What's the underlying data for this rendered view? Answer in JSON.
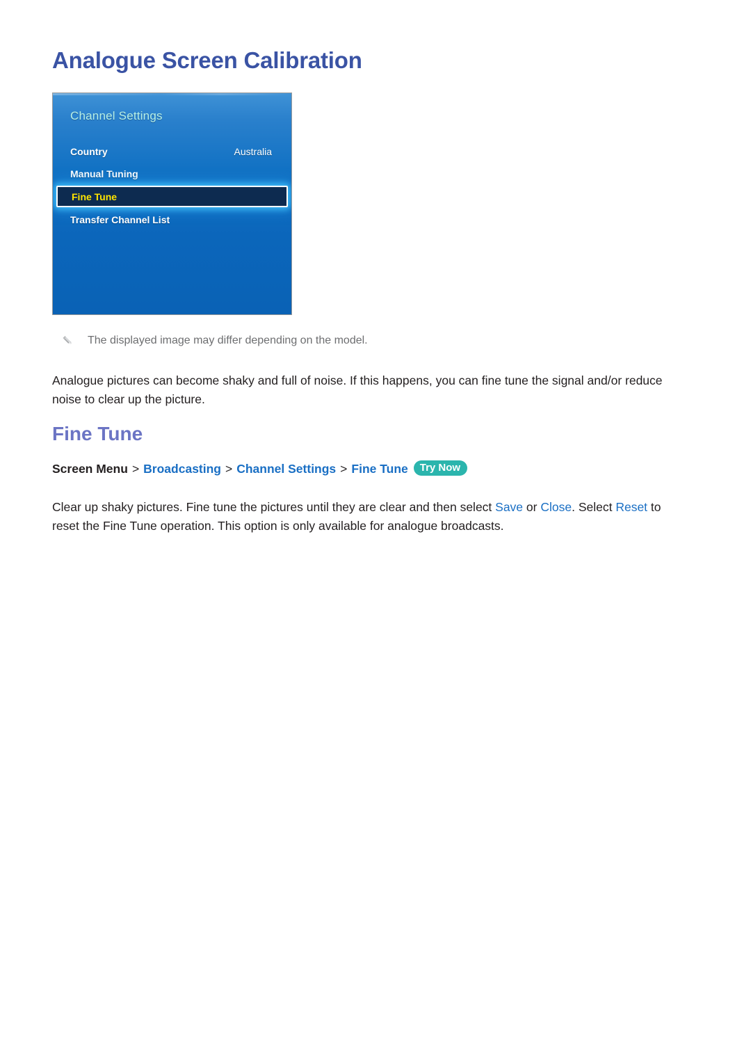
{
  "page": {
    "title": "Analogue Screen Calibration"
  },
  "tv_panel": {
    "title": "Channel Settings",
    "rows": [
      {
        "label": "Country",
        "value": "Australia",
        "selected": false
      },
      {
        "label": "Manual Tuning",
        "value": "",
        "selected": false
      },
      {
        "label": "Fine Tune",
        "value": "",
        "selected": true
      },
      {
        "label": "Transfer Channel List",
        "value": "",
        "selected": false
      }
    ],
    "colors": {
      "panel_top": "#3f92d6",
      "panel_bottom": "#0a62b5",
      "title_text": "#b6efe6",
      "selected_fill": "#0d2b50",
      "selected_text": "#ffe400",
      "selected_glow": "#46c8ff"
    }
  },
  "note": {
    "icon": "pencil-icon",
    "text": "The displayed image may differ depending on the model."
  },
  "intro_paragraph": {
    "text": "Analogue pictures can become shaky and full of noise. If this happens, you can fine tune the signal and/or reduce noise to clear up the picture."
  },
  "section": {
    "heading": "Fine Tune",
    "heading_color": "#6b74c4"
  },
  "breadcrumb": {
    "root": "Screen Menu",
    "separator": ">",
    "links": [
      "Broadcasting",
      "Channel Settings",
      "Fine Tune"
    ],
    "badge": "Try Now",
    "badge_color": "#2bb5ad",
    "link_color": "#1a6fc4"
  },
  "detail_paragraph": {
    "part1": "Clear up shaky pictures. Fine tune the pictures until they are clear and then select ",
    "term_save": "Save",
    "part2": " or ",
    "term_close": "Close",
    "part3": ". Select ",
    "term_reset": "Reset",
    "part4": " to reset the Fine Tune operation. This option is only available for analogue broadcasts."
  }
}
